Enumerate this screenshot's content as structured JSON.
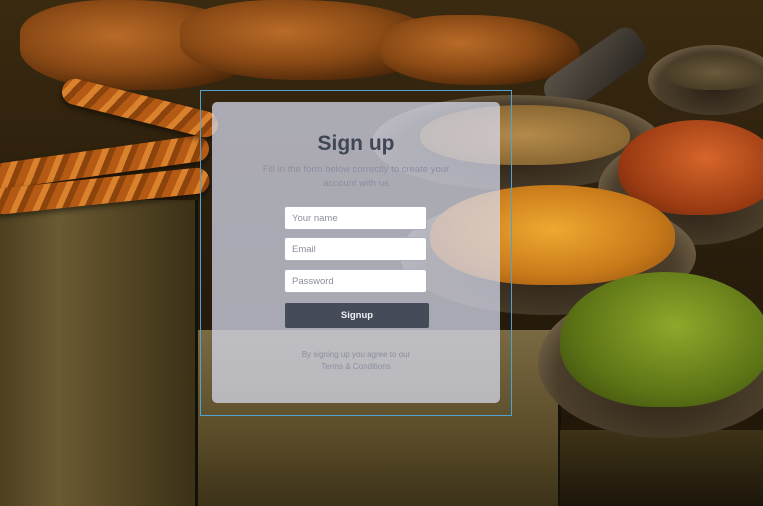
{
  "signup": {
    "title": "Sign up",
    "subtitle": "Fill in the form below correctly to create your account with us",
    "fields": {
      "name_placeholder": "Your name",
      "email_placeholder": "Email",
      "password_placeholder": "Password"
    },
    "submit_label": "Signup",
    "agree_text": "By signing up you agree to our",
    "terms_label": "Terms & Conditions"
  },
  "colors": {
    "card_background": "#d6dbee",
    "button": "#454b58",
    "title_text": "#3f4654",
    "outline": "#4fa3d3"
  }
}
